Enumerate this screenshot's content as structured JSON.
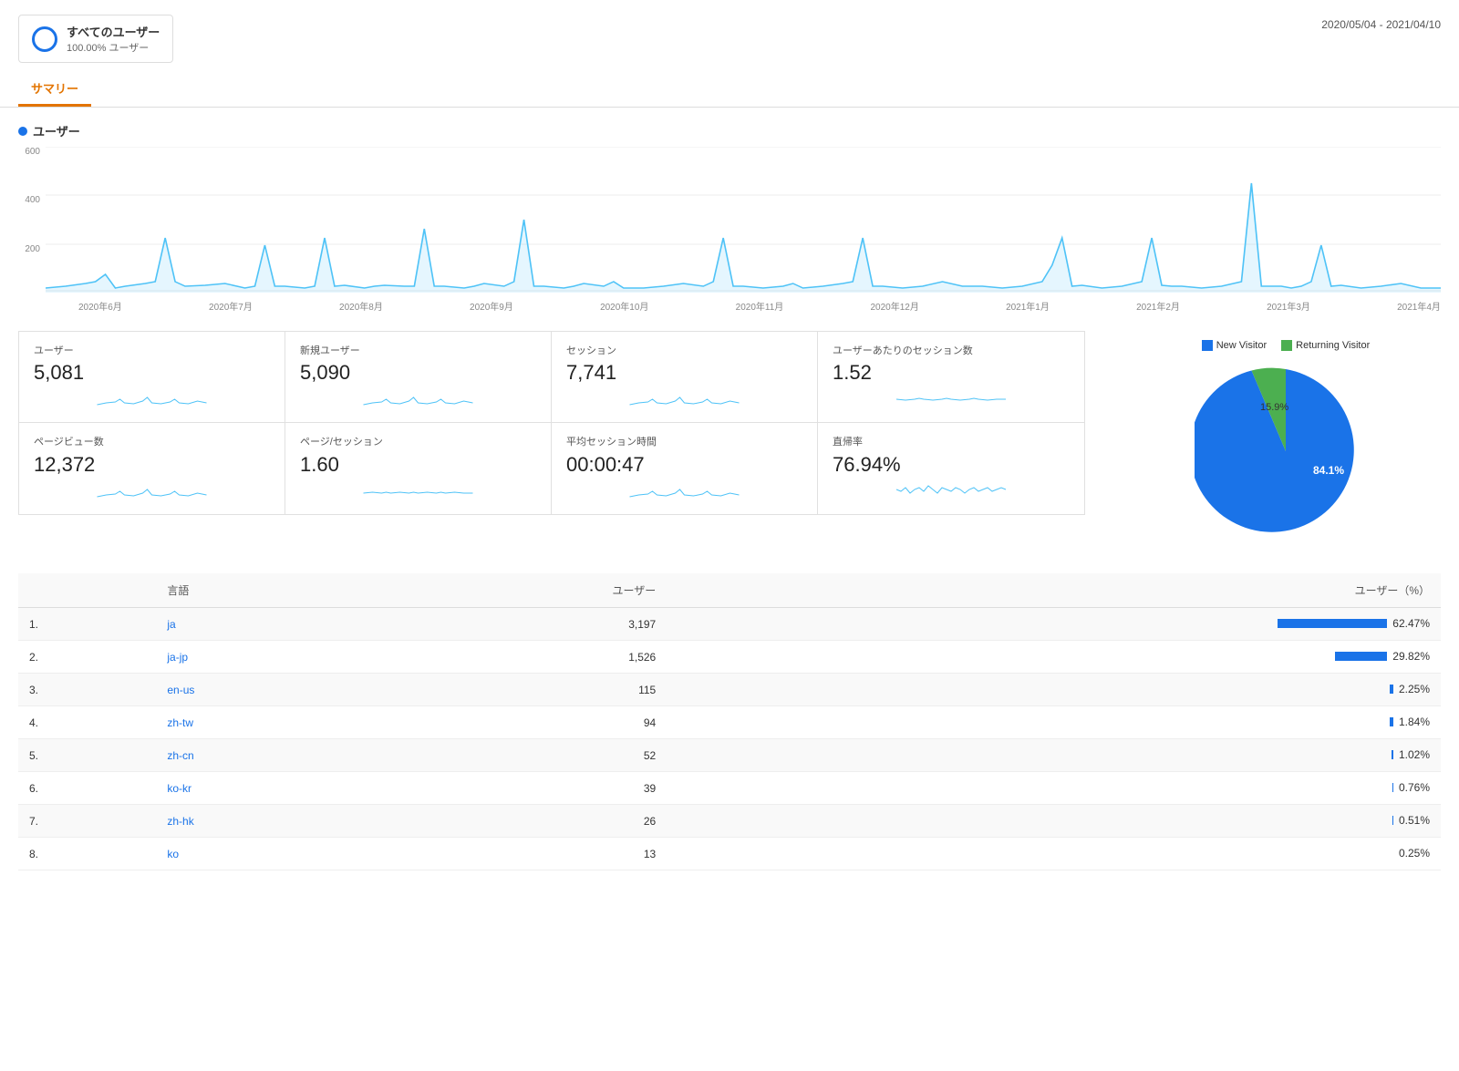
{
  "header": {
    "segment_title": "すべてのユーザー",
    "segment_subtitle": "100.00% ユーザー",
    "date_range": "2020/05/04 - 2021/04/10"
  },
  "tabs": [
    {
      "label": "サマリー",
      "active": true
    }
  ],
  "chart": {
    "legend_label": "ユーザー",
    "y_labels": [
      "600",
      "400",
      "200",
      ""
    ],
    "x_labels": [
      "2020年6月",
      "2020年7月",
      "2020年8月",
      "2020年9月",
      "2020年10月",
      "2020年11月",
      "2020年12月",
      "2021年1月",
      "2021年2月",
      "2021年3月",
      "2021年4月"
    ]
  },
  "metrics_top": [
    {
      "title": "ユーザー",
      "value": "5,081"
    },
    {
      "title": "新規ユーザー",
      "value": "5,090"
    },
    {
      "title": "セッション",
      "value": "7,741"
    },
    {
      "title": "ユーザーあたりのセッション数",
      "value": "1.52"
    }
  ],
  "metrics_bottom": [
    {
      "title": "ページビュー数",
      "value": "12,372"
    },
    {
      "title": "ページ/セッション",
      "value": "1.60"
    },
    {
      "title": "平均セッション時間",
      "value": "00:00:47"
    },
    {
      "title": "直帰率",
      "value": "76.94%"
    }
  ],
  "pie": {
    "new_visitor_label": "New Visitor",
    "returning_visitor_label": "Returning Visitor",
    "new_visitor_pct": 84.1,
    "returning_visitor_pct": 15.9,
    "new_visitor_color": "#1a73e8",
    "returning_visitor_color": "#4caf50",
    "new_visitor_pct_label": "84.1%",
    "returning_visitor_pct_label": "15.9%"
  },
  "table": {
    "col_lang": "言語",
    "col_users": "ユーザー",
    "col_pct": "ユーザー（%）",
    "rows": [
      {
        "rank": "1.",
        "lang": "ja",
        "users": "3,197",
        "pct": 62.47,
        "pct_label": "62.47%"
      },
      {
        "rank": "2.",
        "lang": "ja-jp",
        "users": "1,526",
        "pct": 29.82,
        "pct_label": "29.82%"
      },
      {
        "rank": "3.",
        "lang": "en-us",
        "users": "115",
        "pct": 2.25,
        "pct_label": "2.25%"
      },
      {
        "rank": "4.",
        "lang": "zh-tw",
        "users": "94",
        "pct": 1.84,
        "pct_label": "1.84%"
      },
      {
        "rank": "5.",
        "lang": "zh-cn",
        "users": "52",
        "pct": 1.02,
        "pct_label": "1.02%"
      },
      {
        "rank": "6.",
        "lang": "ko-kr",
        "users": "39",
        "pct": 0.76,
        "pct_label": "0.76%"
      },
      {
        "rank": "7.",
        "lang": "zh-hk",
        "users": "26",
        "pct": 0.51,
        "pct_label": "0.51%"
      },
      {
        "rank": "8.",
        "lang": "ko",
        "users": "13",
        "pct": 0.25,
        "pct_label": "0.25%"
      }
    ]
  }
}
